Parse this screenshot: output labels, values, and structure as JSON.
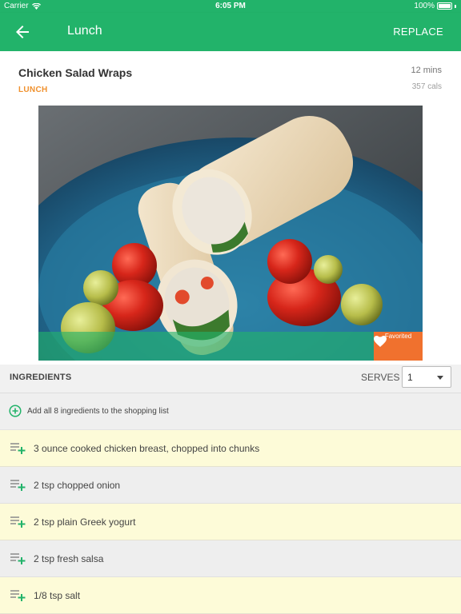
{
  "status_bar": {
    "carrier": "Carrier",
    "time": "6:05 PM",
    "battery": "100%",
    "battery_level": 1.0
  },
  "app_bar": {
    "title": "Lunch",
    "action": "REPLACE"
  },
  "recipe": {
    "title": "Chicken Salad Wraps",
    "category": "LUNCH",
    "time": "12 mins",
    "calories": "357 cals"
  },
  "favorite": {
    "label": "Favorited",
    "active": true
  },
  "ingredients_section": {
    "title": "INGREDIENTS",
    "serves_label": "SERVES",
    "serves_value": "1",
    "add_all_label": "Add all 8 ingredients to the shopping list"
  },
  "ingredients": [
    {
      "text": "3 ounce cooked chicken breast, chopped into chunks"
    },
    {
      "text": "2 tsp chopped onion"
    },
    {
      "text": "2 tsp plain Greek yogurt"
    },
    {
      "text": "2 tsp fresh salsa"
    },
    {
      "text": "1/8 tsp salt"
    }
  ],
  "colors": {
    "primary": "#22b36a",
    "accent_orange": "#f0912e",
    "favorite": "#f0712e",
    "row_highlight": "#fdfbd8"
  }
}
